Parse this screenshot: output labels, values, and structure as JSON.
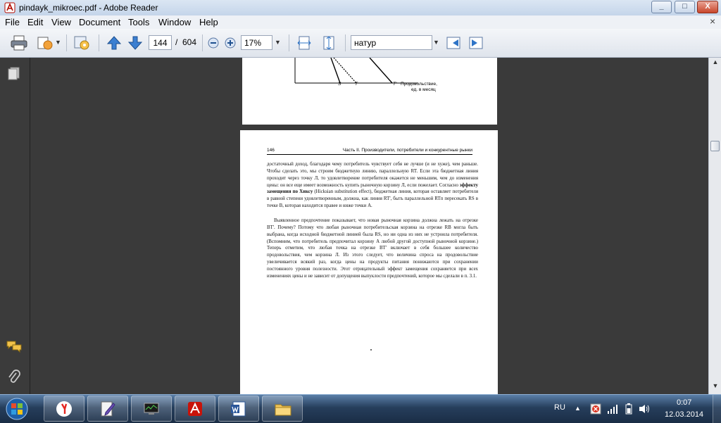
{
  "window": {
    "title": "pindayk_mikroec.pdf - Adobe Reader",
    "minimize_label": "_",
    "maximize_label": "□",
    "close_label": "X"
  },
  "menu": {
    "items": [
      "File",
      "Edit",
      "View",
      "Document",
      "Tools",
      "Window",
      "Help"
    ],
    "close_glyph": "×"
  },
  "toolbar": {
    "page_current": "144",
    "page_separator": "/",
    "page_total": "604",
    "zoom_value": "17%",
    "fit_mode": "натур"
  },
  "document": {
    "top_page": {
      "graph_labels": {
        "s": "S",
        "t": "T",
        "t_prime": "T'",
        "axis_label_line1": "Продовольствие,",
        "axis_label_line2": "ед. в месяц"
      }
    },
    "page": {
      "number": "146",
      "running_header": "Часть II. Производители, потребители и конкурентные рынки",
      "para1_pre": "достаточный доход, благодаря чему потребитель чувствует себя не лучше (и не хуже), чем раньше. Чтобы сделать это, мы строим бюджетную линию, параллельную RT. Если эта бюджетная линия проходит через точку Л, то удовлетворение потребителя окажется не меньшим, чем до изменения цены: он все еще имеет возможность купить рыночную корзину Л, если пожелает. Согласно ",
      "para1_bold": "эффекту замещения по Хиксу",
      "para1_post": " (Hicksian substitution effect), бюджетная линия, которая оставляет потребителя в равной степени удовлетворенным, должна, как линия RT', быть параллельной RTп пересекать RS в точке В, которая находится правее и ниже точки А.",
      "para2": "Выявленное предпочтение показывает, что новая рыночная корзина должна лежать на отрезке ВТ'. Почему? Потому что любая рыночная потребительская корзина на отрезке RB могла быть выбрана, когда исходной бюджетной линией была RS, но ни одна из них не устроила потребителя. (Вспомним, что потребитель предпочитал корзину А любой другой доступной рыночной корзине.) Теперь отметим, что любая точка на отрезке ВТ' включает в себя большее количество продовольствия, чем корзина Л. Из этого следует, что величина спроса на продовольствие увеличивается всякий раз, когда цены на продукты питания понижаются при сохранении постоянного уровня полезности. Этот отрицательный эффект замещения сохраняется при всех изменениях цены и не зависит от допущения выпуклости предпочтений, которое мы сделали в п. 3.1."
    }
  },
  "taskbar": {
    "language": "RU",
    "time": "0:07",
    "date": "12.03.2014"
  },
  "colors": {
    "taskbar": "#263e5c",
    "document_background": "#3a3a3a",
    "toolbar_accent": "#2e74c7"
  }
}
